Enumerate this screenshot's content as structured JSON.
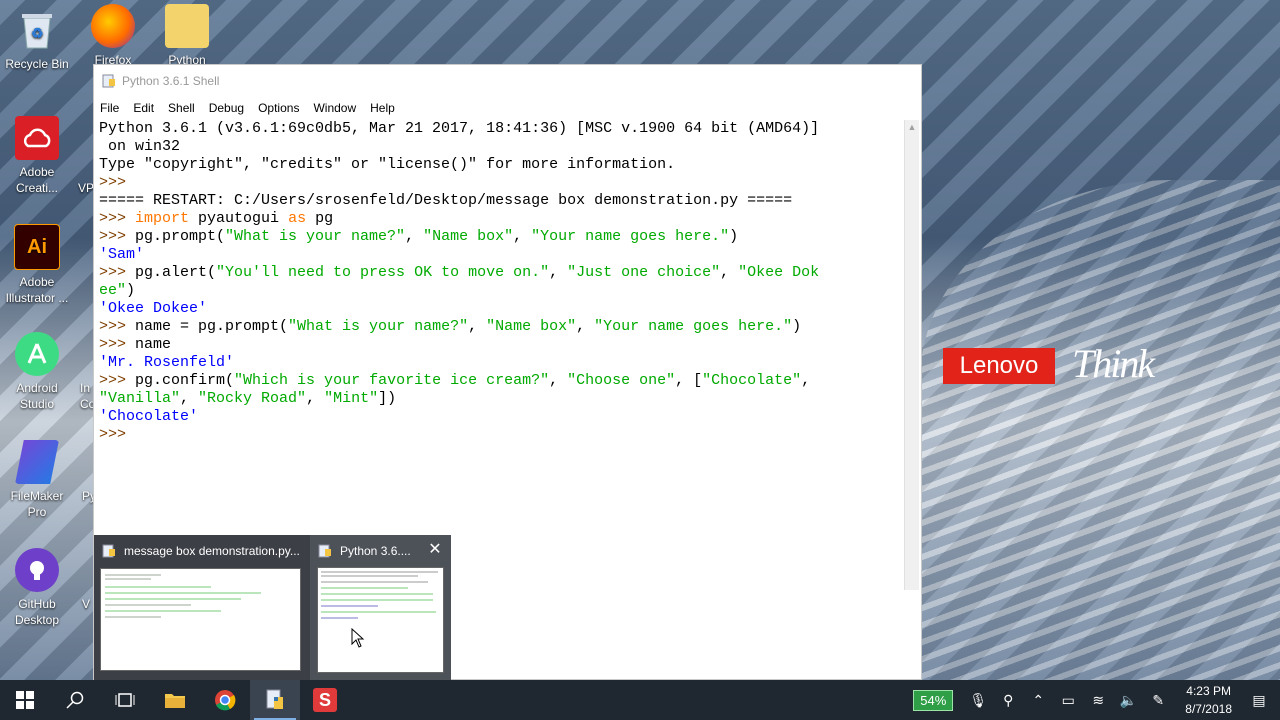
{
  "desktop": {
    "icons": [
      {
        "label": "Recycle Bin"
      },
      {
        "label": "Adobe Creati..."
      },
      {
        "label": "Adobe Illustrator ..."
      },
      {
        "label": "Android Studio"
      },
      {
        "label": "FileMaker Pro"
      },
      {
        "label": "GitHub Desktop"
      }
    ],
    "partial_labels": {
      "firefox": "Firefox",
      "python": "Python",
      "vp": "VP",
      "in": "In",
      "co": "Co",
      "py": "Py",
      "v": "V"
    },
    "brand": {
      "lenovo": "Lenovo",
      "think": "Think"
    }
  },
  "window": {
    "title": "Python 3.6.1 Shell",
    "menu": [
      "File",
      "Edit",
      "Shell",
      "Debug",
      "Options",
      "Window",
      "Help"
    ]
  },
  "console": {
    "lines": [
      [
        {
          "t": "Python 3.6.1 (v3.6.1:69c0db5, Mar 21 2017, 18:41:36) [MSC v.1900 64 bit (AMD64)]",
          "c": ""
        }
      ],
      [
        {
          "t": " on win32",
          "c": ""
        }
      ],
      [
        {
          "t": "Type \"copyright\", \"credits\" or \"license()\" for more information.",
          "c": ""
        }
      ],
      [
        {
          "t": ">>> ",
          "c": "c-prompt"
        }
      ],
      [
        {
          "t": "===== RESTART: C:/Users/srosenfeld/Desktop/message box demonstration.py =====",
          "c": "c-restart"
        }
      ],
      [
        {
          "t": ">>> ",
          "c": "c-prompt"
        },
        {
          "t": "import",
          "c": "c-kw"
        },
        {
          "t": " pyautogui ",
          "c": ""
        },
        {
          "t": "as",
          "c": "c-kw"
        },
        {
          "t": " pg",
          "c": ""
        }
      ],
      [
        {
          "t": ">>> ",
          "c": "c-prompt"
        },
        {
          "t": "pg.prompt(",
          "c": ""
        },
        {
          "t": "\"What is your name?\"",
          "c": "c-str"
        },
        {
          "t": ", ",
          "c": ""
        },
        {
          "t": "\"Name box\"",
          "c": "c-str"
        },
        {
          "t": ", ",
          "c": ""
        },
        {
          "t": "\"Your name goes here.\"",
          "c": "c-str"
        },
        {
          "t": ")",
          "c": ""
        }
      ],
      [
        {
          "t": "'Sam'",
          "c": "c-out"
        }
      ],
      [
        {
          "t": ">>> ",
          "c": "c-prompt"
        },
        {
          "t": "pg.alert(",
          "c": ""
        },
        {
          "t": "\"You'll need to press OK to move on.\"",
          "c": "c-str"
        },
        {
          "t": ", ",
          "c": ""
        },
        {
          "t": "\"Just one choice\"",
          "c": "c-str"
        },
        {
          "t": ", ",
          "c": ""
        },
        {
          "t": "\"Okee Dok",
          "c": "c-str"
        }
      ],
      [
        {
          "t": "ee\"",
          "c": "c-str"
        },
        {
          "t": ")",
          "c": ""
        }
      ],
      [
        {
          "t": "'Okee Dokee'",
          "c": "c-out"
        }
      ],
      [
        {
          "t": ">>> ",
          "c": "c-prompt"
        },
        {
          "t": "name = pg.prompt(",
          "c": ""
        },
        {
          "t": "\"What is your name?\"",
          "c": "c-str"
        },
        {
          "t": ", ",
          "c": ""
        },
        {
          "t": "\"Name box\"",
          "c": "c-str"
        },
        {
          "t": ", ",
          "c": ""
        },
        {
          "t": "\"Your name goes here.\"",
          "c": "c-str"
        },
        {
          "t": ")",
          "c": ""
        }
      ],
      [
        {
          "t": ">>> ",
          "c": "c-prompt"
        },
        {
          "t": "name",
          "c": ""
        }
      ],
      [
        {
          "t": "'Mr. Rosenfeld'",
          "c": "c-out"
        }
      ],
      [
        {
          "t": ">>> ",
          "c": "c-prompt"
        },
        {
          "t": "pg.confirm(",
          "c": ""
        },
        {
          "t": "\"Which is your favorite ice cream?\"",
          "c": "c-str"
        },
        {
          "t": ", ",
          "c": ""
        },
        {
          "t": "\"Choose one\"",
          "c": "c-str"
        },
        {
          "t": ", [",
          "c": ""
        },
        {
          "t": "\"Chocolate\"",
          "c": "c-str"
        },
        {
          "t": ",",
          "c": ""
        }
      ],
      [
        {
          "t": "\"Vanilla\"",
          "c": "c-str"
        },
        {
          "t": ", ",
          "c": ""
        },
        {
          "t": "\"Rocky Road\"",
          "c": "c-str"
        },
        {
          "t": ", ",
          "c": ""
        },
        {
          "t": "\"Mint\"",
          "c": "c-str"
        },
        {
          "t": "])",
          "c": ""
        }
      ],
      [
        {
          "t": "'Chocolate'",
          "c": "c-out"
        }
      ],
      [
        {
          "t": ">>> ",
          "c": "c-prompt"
        }
      ]
    ]
  },
  "preview": {
    "items": [
      {
        "title": "message box demonstration.py..."
      },
      {
        "title": "Python 3.6...."
      }
    ]
  },
  "taskbar": {
    "battery": "54%",
    "time": "4:23 PM",
    "date": "8/7/2018"
  }
}
